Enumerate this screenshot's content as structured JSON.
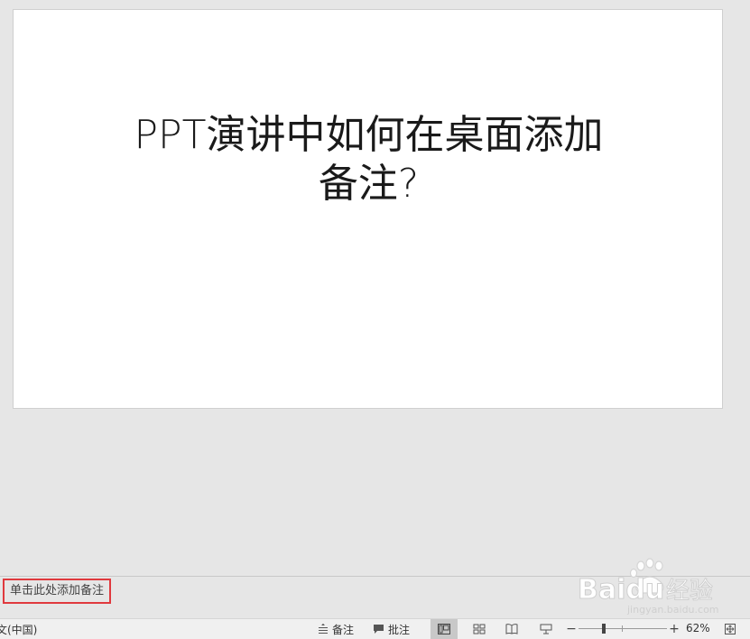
{
  "slide": {
    "title_line1": "PPT演讲中如何在桌面添加",
    "title_line2": "备注?"
  },
  "notes": {
    "placeholder": "单击此处添加备注"
  },
  "watermark": {
    "brand": "Baidu",
    "product": "经验",
    "url": "jingyan.baidu.com"
  },
  "status_bar": {
    "language": "文(中国)",
    "notes_label": "备注",
    "comments_label": "批注",
    "zoom_level": 62,
    "zoom_text": "62%",
    "zoom_minus": "−",
    "zoom_plus": "+",
    "active_view": "normal"
  },
  "colors": {
    "background": "#e6e6e6",
    "highlight_border": "#e0393e",
    "status_bar": "#f0f0f0"
  }
}
